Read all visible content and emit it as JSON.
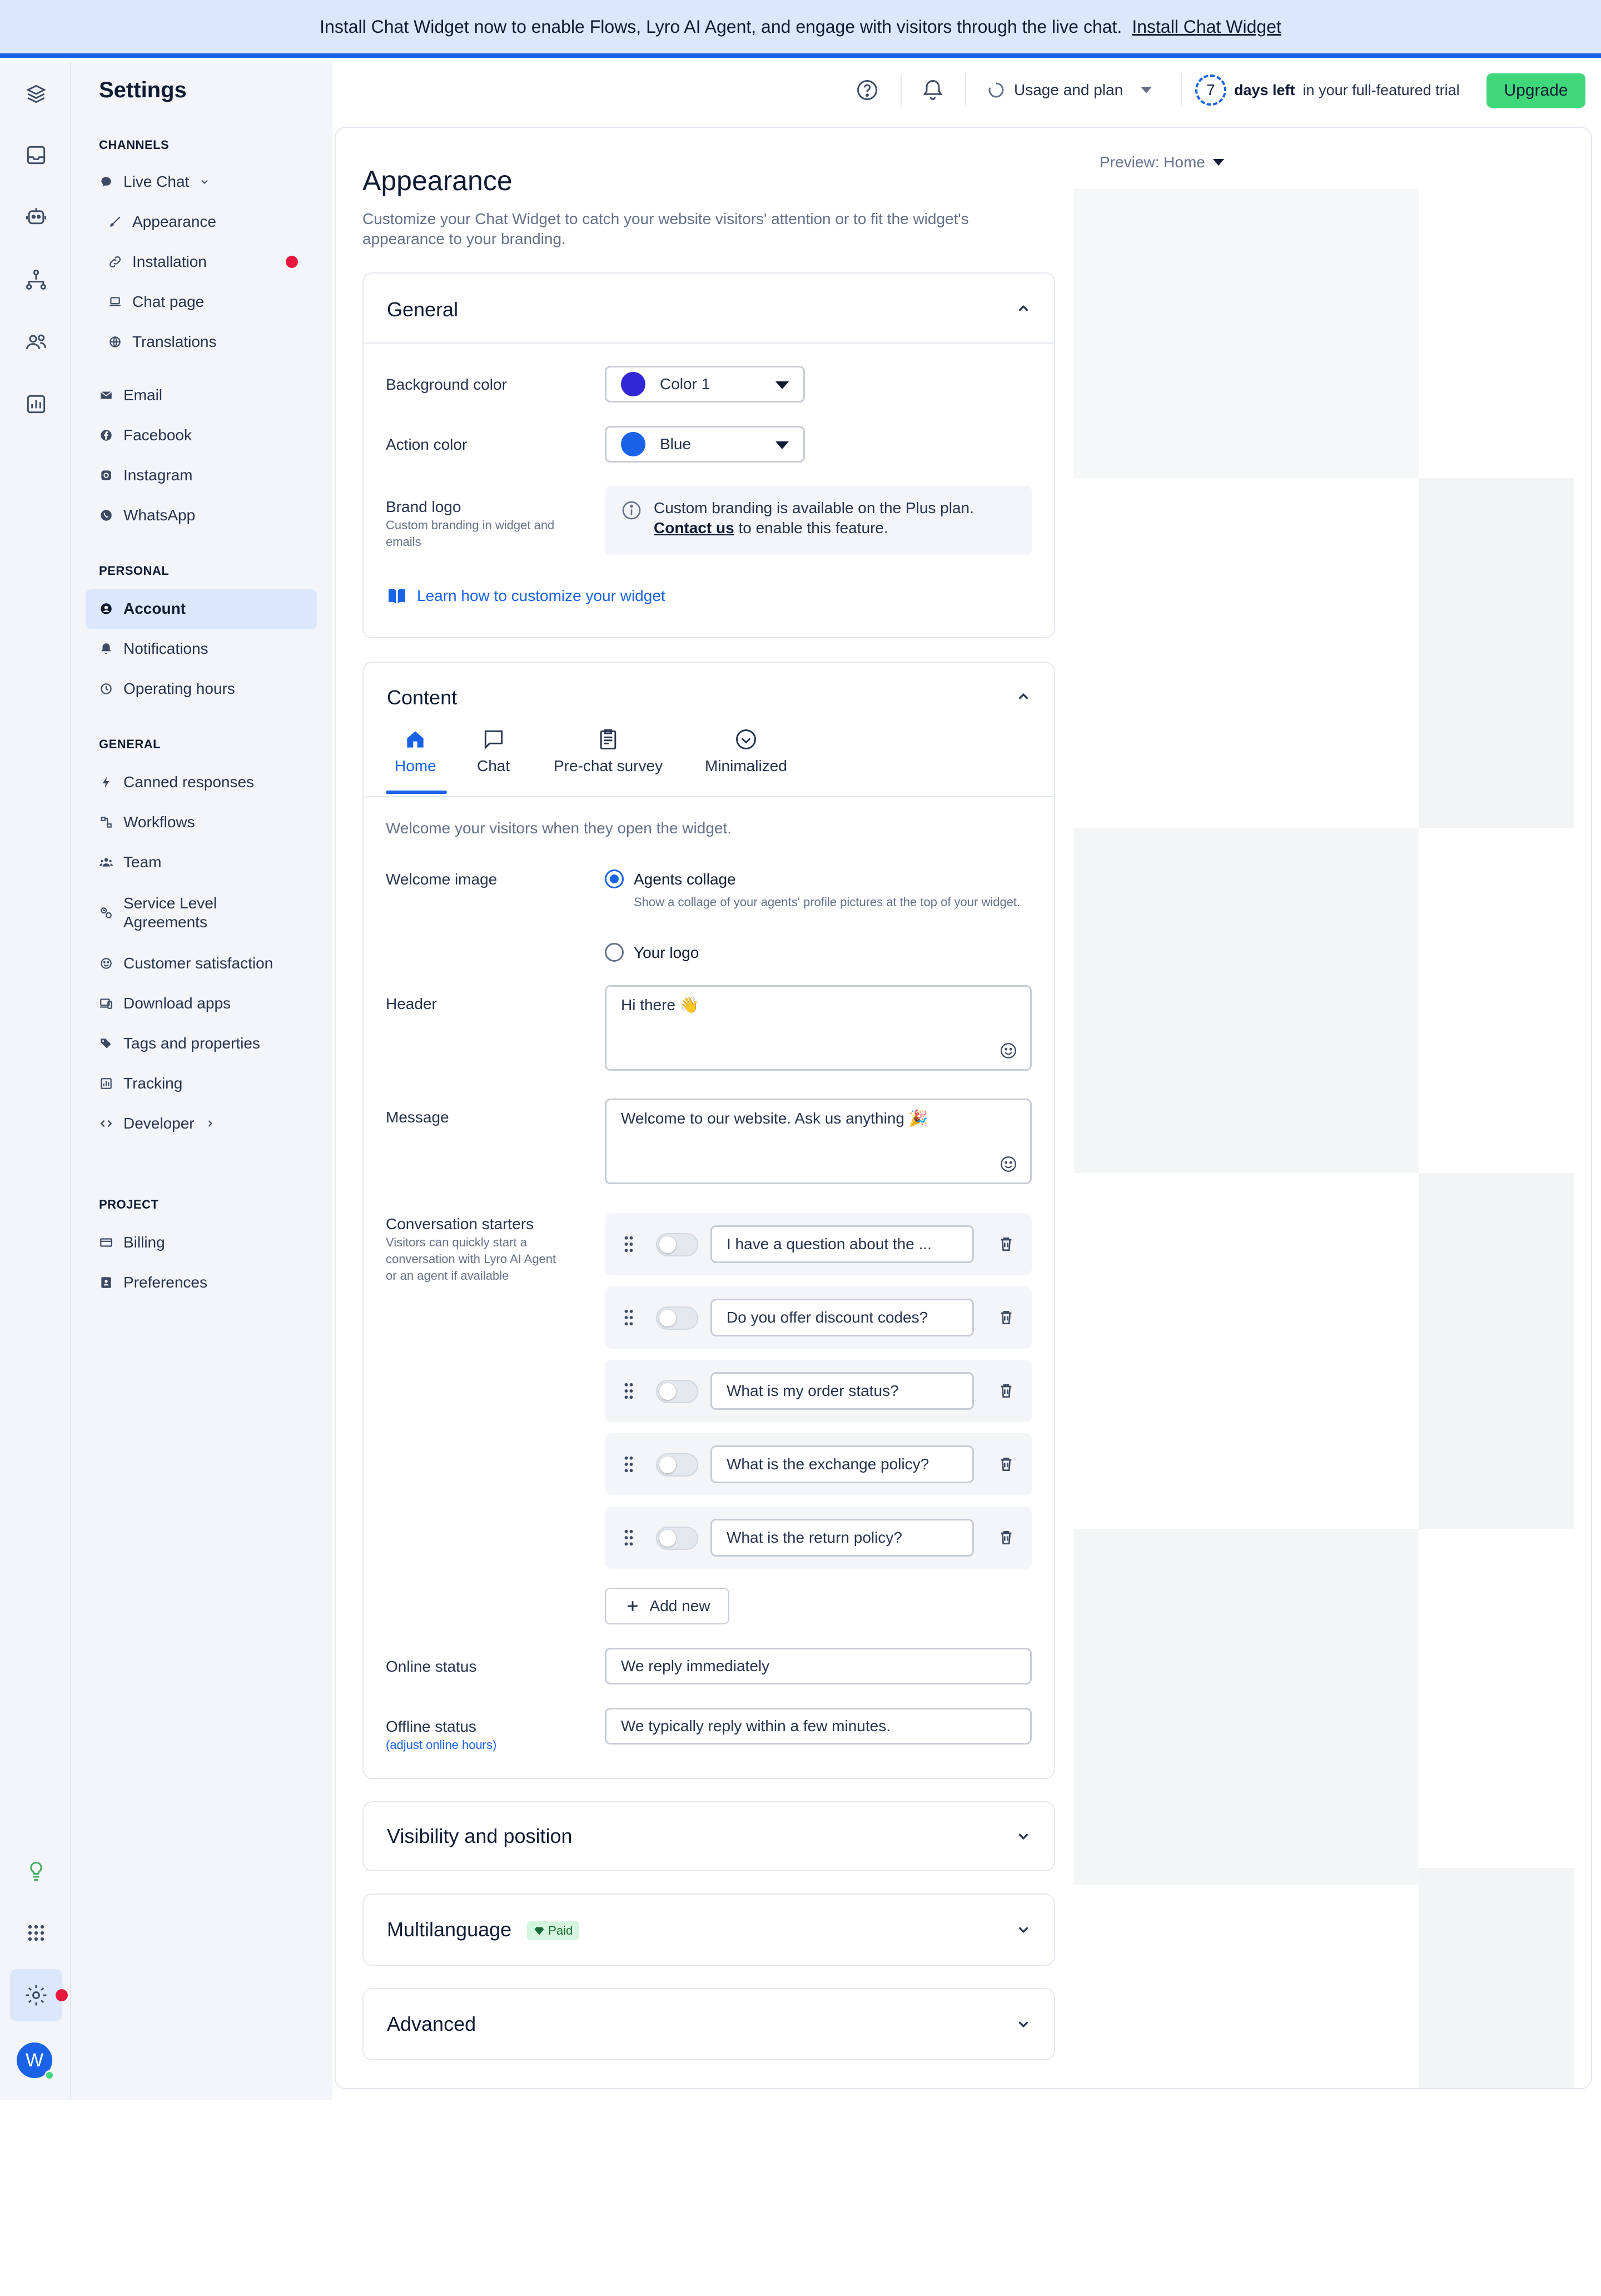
{
  "banner": {
    "text": "Install Chat Widget now to enable Flows, Lyro AI Agent, and engage with visitors through the live chat.",
    "link": "Install Chat Widget"
  },
  "header": {
    "title": "Settings",
    "usage_label": "Usage and plan",
    "trial_days": "7",
    "trial_bold": "days left",
    "trial_rest": "in your full-featured trial",
    "upgrade_label": "Upgrade"
  },
  "sidebar": {
    "channels_heading": "CHANNELS",
    "live_chat": "Live Chat",
    "live_chat_items": [
      "Appearance",
      "Installation",
      "Chat page",
      "Translations"
    ],
    "channel_items": [
      "Email",
      "Facebook",
      "Instagram",
      "WhatsApp"
    ],
    "personal_heading": "PERSONAL",
    "personal_items": [
      "Account",
      "Notifications",
      "Operating hours"
    ],
    "general_heading": "GENERAL",
    "general_items": [
      "Canned responses",
      "Workflows",
      "Team",
      "Service Level Agreements",
      "Customer satisfaction",
      "Download apps",
      "Tags and properties",
      "Tracking",
      "Developer"
    ],
    "project_heading": "PROJECT",
    "project_items": [
      "Billing",
      "Preferences"
    ],
    "avatar_letter": "W"
  },
  "main": {
    "title": "Appearance",
    "description": "Customize your Chat Widget to catch your website visitors' attention or to fit the widget's appearance to your branding.",
    "general": {
      "title": "General",
      "background_label": "Background color",
      "background_value": "Color 1",
      "background_color": "#3227d6",
      "action_label": "Action color",
      "action_value": "Blue",
      "action_color": "#1a63e8",
      "logo_label": "Brand logo",
      "logo_sub": "Custom branding in widget and emails",
      "logo_info": "Custom branding is available on the Plus plan.",
      "logo_contact": "Contact us",
      "logo_info_rest": "to enable this feature.",
      "learn_link": "Learn how to customize your widget"
    },
    "content": {
      "title": "Content",
      "tabs": [
        "Home",
        "Chat",
        "Pre-chat survey",
        "Minimalized"
      ],
      "intro": "Welcome your visitors when they open the widget.",
      "welcome_image_label": "Welcome image",
      "option_collage": "Agents collage",
      "option_collage_desc": "Show a collage of your agents' profile pictures at the top of your widget.",
      "option_logo": "Your logo",
      "header_label": "Header",
      "header_value": "Hi there 👋",
      "message_label": "Message",
      "message_value": "Welcome to our website. Ask us anything 🎉",
      "starters_label": "Conversation starters",
      "starters_sub": "Visitors can quickly start a conversation with Lyro AI Agent or an agent if available",
      "starters": [
        "I have a question about the ...",
        "Do you offer discount codes?",
        "What is my order status?",
        "What is the exchange policy?",
        "What is the return policy?"
      ],
      "add_new": "Add new",
      "online_label": "Online status",
      "online_value": "We reply immediately",
      "offline_label": "Offline status",
      "offline_sub": "(adjust online hours)",
      "offline_value": "We typically reply within a few minutes."
    },
    "visibility_title": "Visibility and position",
    "multilanguage_title": "Multilanguage",
    "paid_badge": "Paid",
    "advanced_title": "Advanced"
  },
  "preview": {
    "label": "Preview: Home"
  }
}
